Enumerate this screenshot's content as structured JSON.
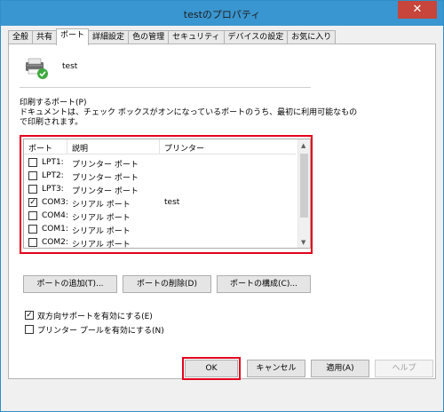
{
  "window": {
    "title": "testのプロパティ",
    "close_glyph": "✕"
  },
  "tabs": [
    {
      "label": "全般"
    },
    {
      "label": "共有"
    },
    {
      "label": "ポート",
      "active": true
    },
    {
      "label": "詳細設定"
    },
    {
      "label": "色の管理"
    },
    {
      "label": "セキュリティ"
    },
    {
      "label": "デバイスの設定"
    },
    {
      "label": "お気に入り"
    }
  ],
  "printer": {
    "name": "test",
    "icon": "printer-icon"
  },
  "ports_section": {
    "title": "印刷するポート(P)",
    "description_line1": "ドキュメントは、チェック ボックスがオンになっているポートのうち、最初に利用可能なもの",
    "description_line2": "で印刷されます。"
  },
  "port_table": {
    "headers": [
      "ポート",
      "説明",
      "プリンター"
    ],
    "rows": [
      {
        "checked": false,
        "port": "LPT1:",
        "description": "プリンター ポート",
        "printer": ""
      },
      {
        "checked": false,
        "port": "LPT2:",
        "description": "プリンター ポート",
        "printer": ""
      },
      {
        "checked": false,
        "port": "LPT3:",
        "description": "プリンター ポート",
        "printer": ""
      },
      {
        "checked": true,
        "port": "COM3:",
        "description": "シリアル ポート",
        "printer": "test"
      },
      {
        "checked": false,
        "port": "COM4:",
        "description": "シリアル ポート",
        "printer": ""
      },
      {
        "checked": false,
        "port": "COM1:",
        "description": "シリアル ポート",
        "printer": ""
      },
      {
        "checked": false,
        "port": "COM2:",
        "description": "シリアル ポート",
        "printer": ""
      }
    ]
  },
  "port_buttons": {
    "add": "ポートの追加(T)...",
    "delete": "ポートの削除(D)",
    "configure": "ポートの構成(C)..."
  },
  "options": {
    "bidirectional": {
      "label": "双方向サポートを有効にする(E)",
      "checked": true
    },
    "pooling": {
      "label": "プリンター プールを有効にする(N)",
      "checked": false
    }
  },
  "dialog_buttons": {
    "ok": "OK",
    "cancel": "キャンセル",
    "apply": "適用(A)",
    "help": "ヘルプ"
  },
  "check_glyph": "✓",
  "colors": {
    "titlebar": "#3a96d0",
    "close": "#c7453a",
    "highlight": "#e4001c"
  }
}
